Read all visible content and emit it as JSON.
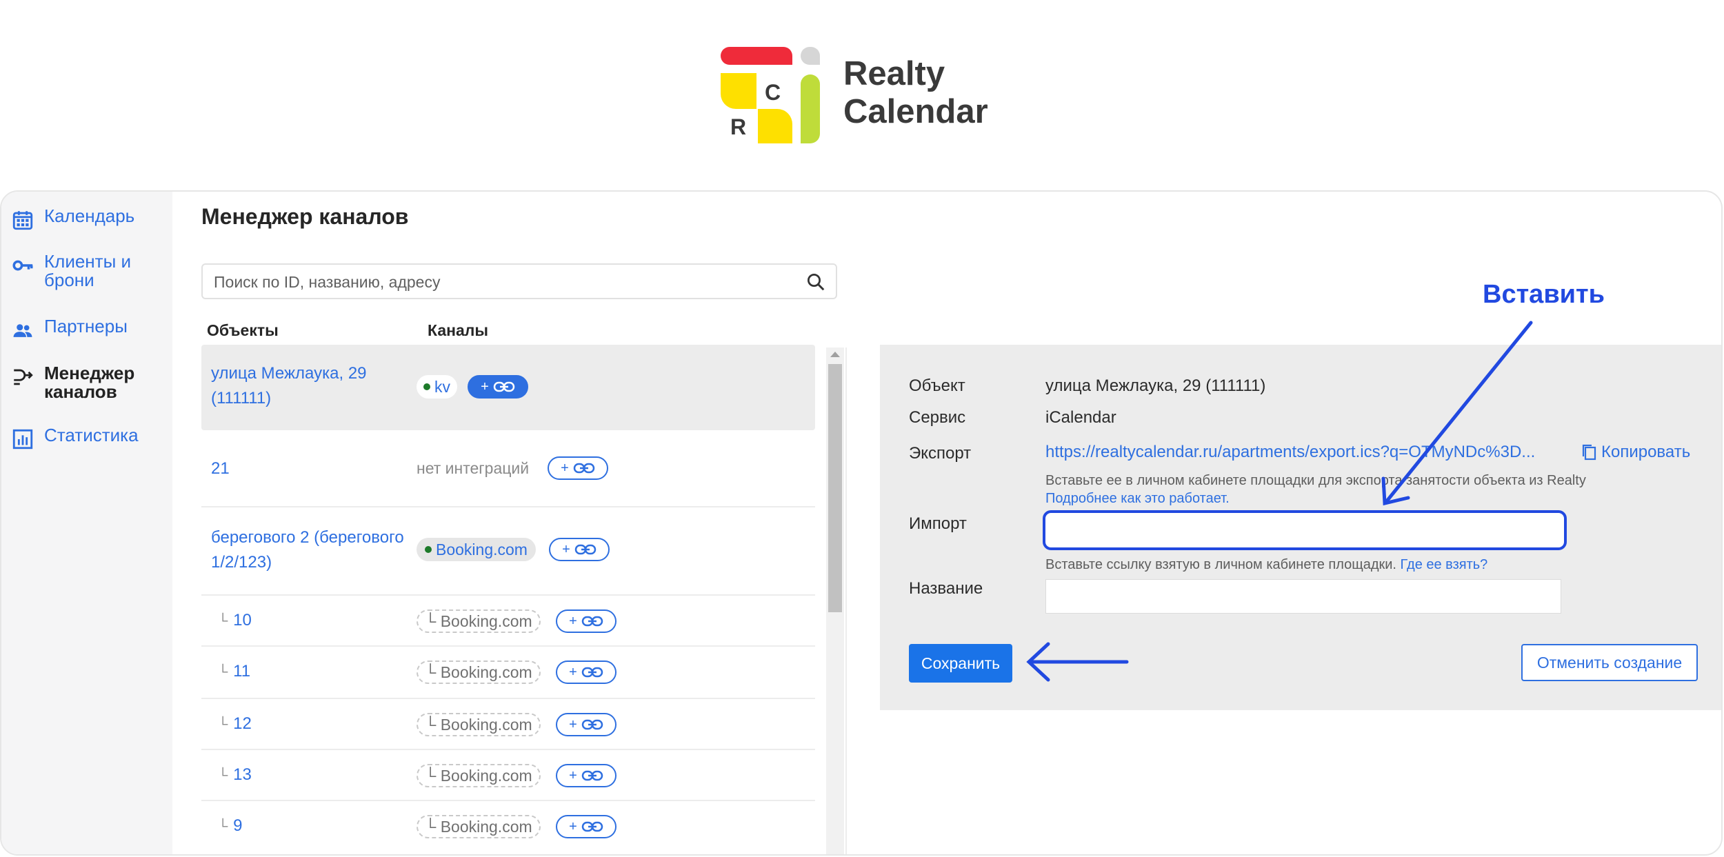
{
  "brand": {
    "logo_c": "C",
    "logo_r": "R",
    "line1": "Realty",
    "line2": "Calendar"
  },
  "sidebar": {
    "items": [
      {
        "label": "Календарь",
        "icon": "calendar-icon"
      },
      {
        "label": "Клиенты и брони",
        "icon": "key-icon"
      },
      {
        "label": "Партнеры",
        "icon": "people-icon"
      },
      {
        "label": "Менеджер каналов",
        "icon": "channel-manager-icon",
        "active": true
      },
      {
        "label": "Статистика",
        "icon": "chart-icon"
      }
    ]
  },
  "main": {
    "title": "Менеджер каналов",
    "search_placeholder": "Поиск по ID, названию, адресу",
    "col_objects": "Объекты",
    "col_channels": "Каналы"
  },
  "rows": [
    {
      "name": "улица Межлаука, 29 (111111)",
      "chip": "kv",
      "link_plus": "+"
    },
    {
      "name": "21",
      "no_integrations": "нет интеграций",
      "link_plus": "+"
    },
    {
      "name": "берегового 2 (берегового 1/2/123)",
      "chip": "Booking.com",
      "link_plus": "+"
    },
    {
      "name": "10",
      "chip": "Booking.com",
      "link_plus": "+"
    },
    {
      "name": "11",
      "chip": "Booking.com",
      "link_plus": "+"
    },
    {
      "name": "12",
      "chip": "Booking.com",
      "link_plus": "+"
    },
    {
      "name": "13",
      "chip": "Booking.com",
      "link_plus": "+"
    },
    {
      "name": "9",
      "chip": "Booking.com",
      "link_plus": "+"
    }
  ],
  "tree_mark": "└",
  "form": {
    "object_label": "Объект",
    "object_value": "улица Межлаука, 29 (111111)",
    "service_label": "Сервис",
    "service_value": "iCalendar",
    "export_label": "Экспорт",
    "export_url": "https://realtycalendar.ru/apartments/export.ics?q=OTMyNDc%3D...",
    "copy_label": "Копировать",
    "export_hint": "Вставьте ее в личном кабинете площадки для экспорта занятости объекта из Realty",
    "export_more": "Подробнее как это работает.",
    "import_label": "Импорт",
    "import_value": "",
    "import_hint": "Вставьте ссылку взятую в личном кабинете площадки.",
    "import_where": "Где ее взять?",
    "name_label": "Название",
    "name_value": "",
    "save_label": "Сохранить",
    "cancel_label": "Отменить создание"
  },
  "annotation": {
    "label": "Вставить",
    "color": "#2149e0"
  },
  "colors": {
    "accent": "#2e6fe0",
    "save": "#1a73e8",
    "brand_red": "#ef2b3a",
    "brand_yellow": "#fee000",
    "brand_green": "#bfdc3a"
  }
}
